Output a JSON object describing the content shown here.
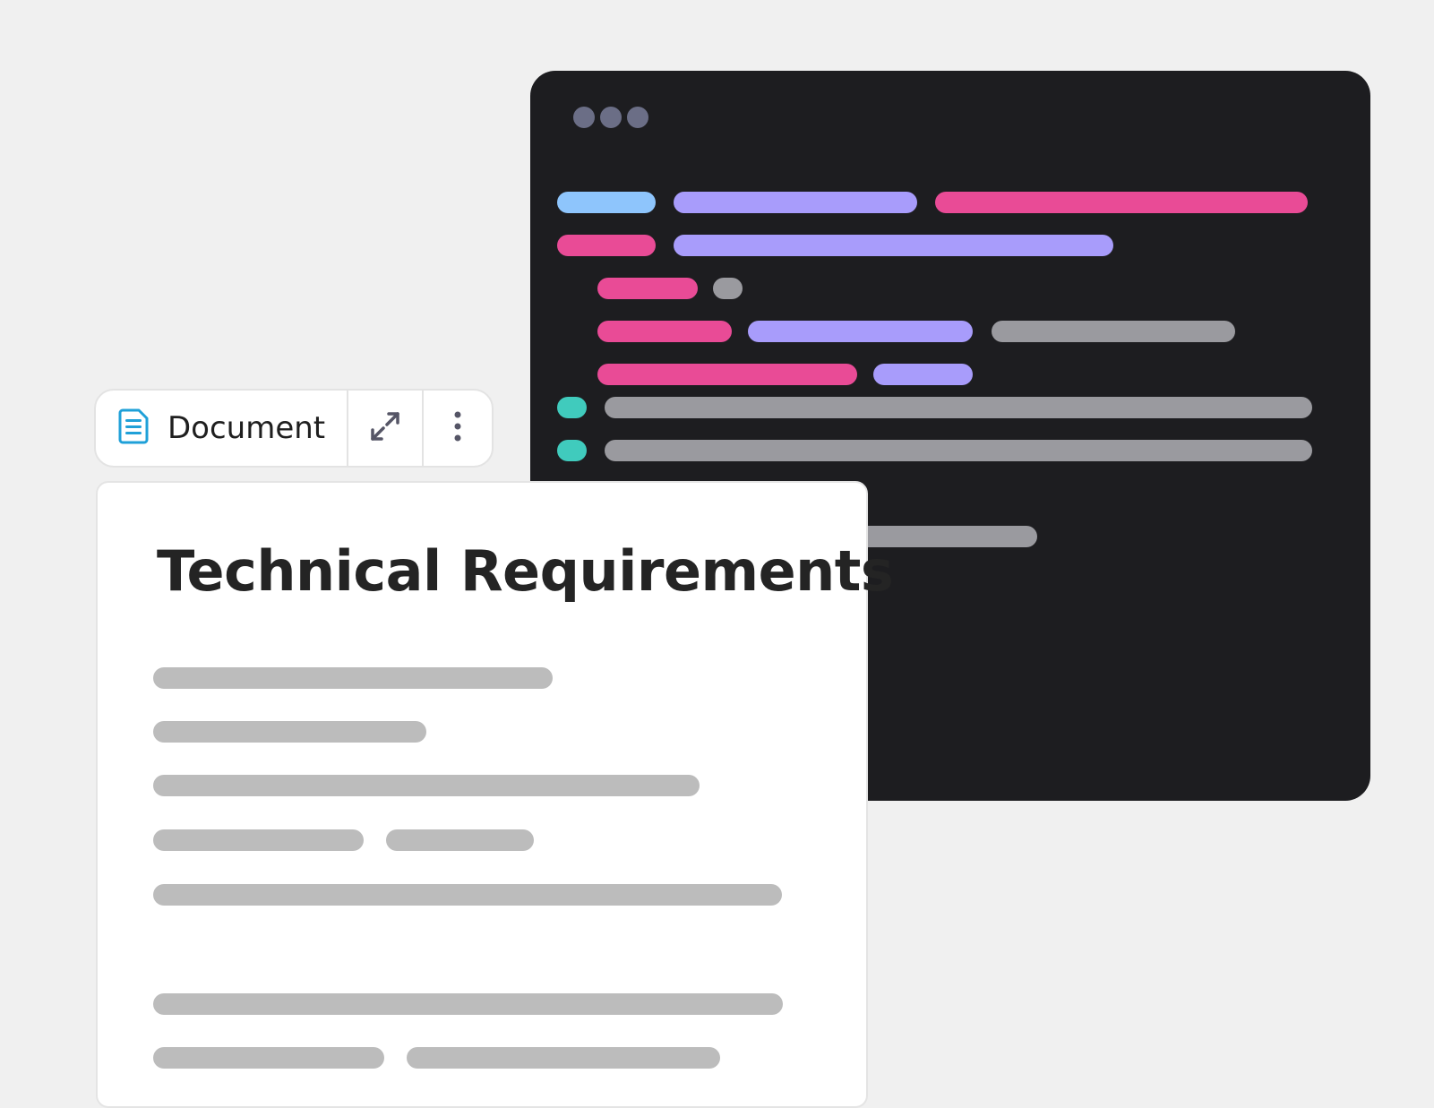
{
  "colors": {
    "background": "#f0f0f0",
    "code_window": "#1d1d20",
    "window_dot": "#6b6e86",
    "token_blue": "#8ec5fc",
    "token_purple": "#a89cfb",
    "token_pink": "#e94b96",
    "token_gray": "#9a9a9f",
    "token_teal": "#40cbbd",
    "text_placeholder": "#bcbcbc",
    "doc_icon": "#1fa0d8"
  },
  "toolbar": {
    "doc_icon": "document-icon",
    "label": "Document",
    "expand_icon": "expand-arrows-icon",
    "more_icon": "vertical-dots-icon"
  },
  "document": {
    "title": "Technical Requirements"
  }
}
